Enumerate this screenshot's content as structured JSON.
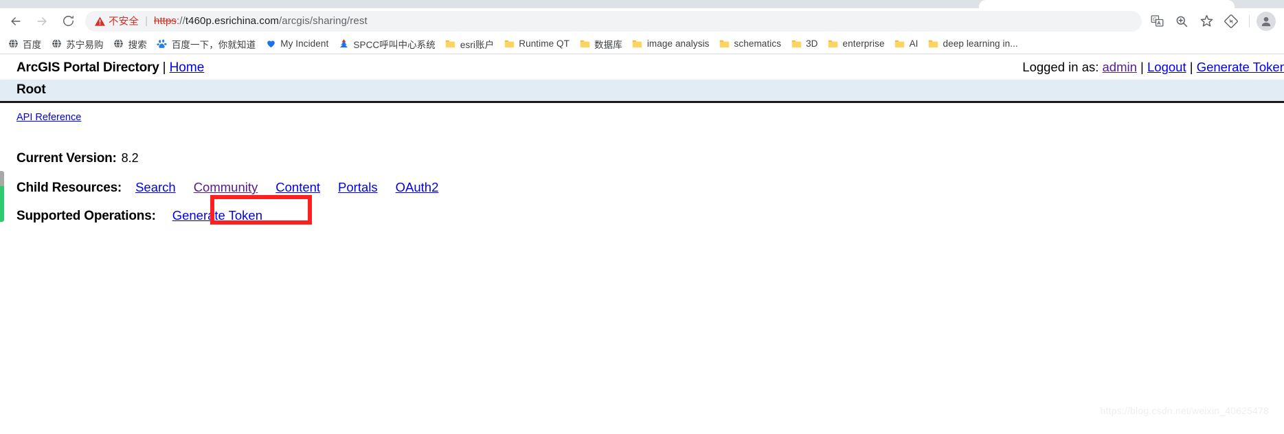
{
  "browser": {
    "nav": {
      "back_label": "Back",
      "forward_label": "Forward",
      "reload_label": "Reload"
    },
    "omnibox": {
      "security_warning": "不安全",
      "security_icon": "warning-triangle-icon",
      "url_scheme": "https",
      "url_separator": "://",
      "url_host": "t460p.esrichina.com",
      "url_path": "/arcgis/sharing/rest",
      "full_url": "https://t460p.esrichina.com/arcgis/sharing/rest"
    },
    "toolbar_icons": [
      {
        "name": "translate-icon",
        "label": "Translate"
      },
      {
        "name": "zoom-search-icon",
        "label": "Zoom"
      },
      {
        "name": "bookmark-star-icon",
        "label": "Bookmark"
      },
      {
        "name": "extension-diamond-icon",
        "label": "Extension"
      },
      {
        "name": "profile-avatar-icon",
        "label": "Profile"
      }
    ],
    "bookmarks": [
      {
        "label": "百度",
        "icon": "globe-icon"
      },
      {
        "label": "苏宁易购",
        "icon": "globe-icon"
      },
      {
        "label": "搜索",
        "icon": "globe-icon"
      },
      {
        "label": "百度一下，你就知道",
        "icon": "baidu-paw-icon"
      },
      {
        "label": "My Incident",
        "icon": "heart-icon"
      },
      {
        "label": "SPCC呼叫中心系统",
        "icon": "tower-icon"
      },
      {
        "label": "esri账户",
        "icon": "folder-icon"
      },
      {
        "label": "Runtime QT",
        "icon": "folder-icon"
      },
      {
        "label": "数据库",
        "icon": "folder-icon"
      },
      {
        "label": "image analysis",
        "icon": "folder-icon"
      },
      {
        "label": "schematics",
        "icon": "folder-icon"
      },
      {
        "label": "3D",
        "icon": "folder-icon"
      },
      {
        "label": "enterprise",
        "icon": "folder-icon"
      },
      {
        "label": "AI",
        "icon": "folder-icon"
      },
      {
        "label": "deep learning in...",
        "icon": "folder-icon"
      }
    ]
  },
  "page": {
    "header": {
      "title": "ArcGIS Portal Directory",
      "separator": "|",
      "home_link": "Home",
      "logged_in_prefix": "Logged in as:",
      "user": "admin",
      "sep1": "|",
      "logout": "Logout",
      "sep2": "|",
      "generate_token": "Generate Token"
    },
    "root_bar": "Root",
    "api_reference": "API Reference",
    "current_version": {
      "label": "Current Version:",
      "value": "8.2"
    },
    "child_resources": {
      "label": "Child Resources:",
      "items": [
        "Search",
        "Community",
        "Content",
        "Portals",
        "OAuth2"
      ],
      "visited": [
        "Community"
      ]
    },
    "supported_operations": {
      "label": "Supported Operations:",
      "items": [
        "Generate Token"
      ]
    },
    "annotation": {
      "type": "red-rectangle",
      "target": "Community",
      "color": "#ff2020"
    },
    "watermark": "https://blog.csdn.net/weixin_40625478"
  },
  "colors": {
    "link": "#0000ee",
    "visited_link": "#551a8b",
    "warning_red": "#d93025",
    "annotation_red": "#ff2020",
    "root_bar_bg": "#e2ecf4",
    "marker_green": "#2ecc71"
  }
}
